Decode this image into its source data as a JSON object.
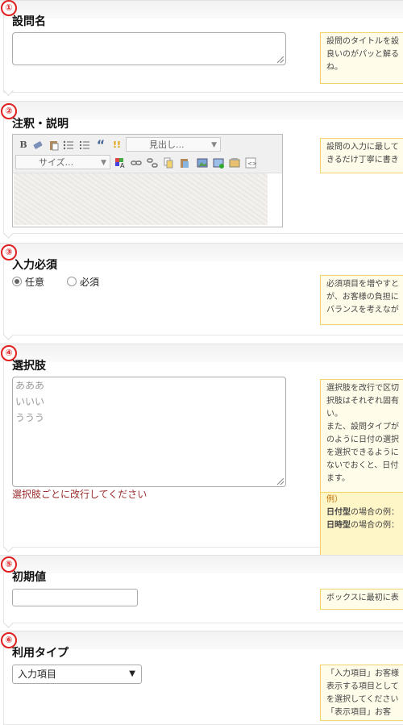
{
  "sections": [
    {
      "num": "①",
      "title": "設問名",
      "help": [
        "設問のタイトルを設",
        "良いのがパッと解る",
        "ね。"
      ]
    },
    {
      "num": "②",
      "title": "注釈・説明",
      "help": [
        "設問の入力に最して",
        "きるだけ丁寧に書き"
      ],
      "editor": {
        "heading_select": "見出し...",
        "size_select": "サイズ...",
        "icons": {
          "bold": "B",
          "quote": "“",
          "warn": "!!"
        }
      }
    },
    {
      "num": "③",
      "title": "入力必須",
      "radios": [
        {
          "label": "任意",
          "checked": true
        },
        {
          "label": "必須",
          "checked": false
        }
      ],
      "help": [
        "必須項目を増やすと",
        "が、お客様の負担に",
        "バランスを考えなが"
      ]
    },
    {
      "num": "④",
      "title": "選択肢",
      "choices": [
        "あああ",
        "いいい",
        "ううう"
      ],
      "hint": "選択肢ごとに改行してください",
      "help": [
        "選択肢を改行で区切",
        "択肢はそれぞれ固有",
        "い。",
        "また、設問タイプが",
        "のように日付の選択",
        "を選択できるように",
        "ないでおくと、日付",
        "ます。"
      ],
      "example": {
        "label": "例）",
        "lines": [
          {
            "bold": "日付型",
            "rest": "の場合の例："
          },
          {
            "bold": "日時型",
            "rest": "の場合の例："
          }
        ]
      }
    },
    {
      "num": "⑤",
      "title": "初期値",
      "help": [
        "ボックスに最初に表"
      ]
    },
    {
      "num": "⑥",
      "title": "利用タイプ",
      "select": "入力項目",
      "help": [
        "「入力項目」お客様",
        "表示する項目として",
        "を選択してください",
        "「表示項目」お客"
      ]
    }
  ]
}
